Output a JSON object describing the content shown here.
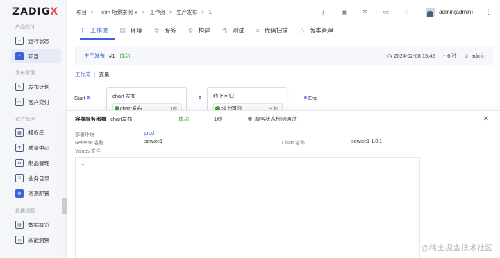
{
  "brand": {
    "logo_main": "ZADIG",
    "logo_accent": "X"
  },
  "sidebar": {
    "sections": [
      {
        "label": "产品交付",
        "items": [
          {
            "label": "运行状态",
            "icon": "pulse-icon"
          },
          {
            "label": "项目",
            "icon": "project-icon",
            "active": true
          }
        ]
      },
      {
        "label": "发布管理",
        "items": [
          {
            "label": "发布计划",
            "icon": "edit-icon"
          },
          {
            "label": "客户交付",
            "icon": "delivery-icon"
          }
        ]
      },
      {
        "label": "资产管理",
        "items": [
          {
            "label": "模板库",
            "icon": "template-icon"
          },
          {
            "label": "质量中心",
            "icon": "quality-icon"
          },
          {
            "label": "制品管理",
            "icon": "artifact-icon"
          },
          {
            "label": "业务目录",
            "icon": "catalog-icon"
          },
          {
            "label": "资源配置",
            "icon": "resource-icon"
          }
        ]
      },
      {
        "label": "数据视图",
        "items": [
          {
            "label": "数据概览",
            "icon": "overview-icon"
          },
          {
            "label": "效能洞察",
            "icon": "insight-icon"
          }
        ]
      }
    ]
  },
  "topbar": {
    "breadcrumb": [
      "项目",
      "Helm 场景案例",
      "工作流",
      "生产发布",
      "1"
    ],
    "user": "admin(admin)"
  },
  "tabs": [
    "工作流",
    "环境",
    "服务",
    "构建",
    "测试",
    "代码扫描",
    "版本管理"
  ],
  "run": {
    "name": "生产发布",
    "number": "#1",
    "status": "成功",
    "time": "2024-02-08 15:42",
    "duration": "6 秒",
    "creator": "admin"
  },
  "subtabs": [
    "工作流",
    "变量"
  ],
  "workflow": {
    "start_label": "Start",
    "end_label": "End",
    "stages": [
      {
        "title": "chart 发布",
        "job": "chart发布",
        "duration": "1秒"
      },
      {
        "title": "线上回归",
        "job": "线上回归",
        "duration": "5 秒"
      }
    ]
  },
  "drawer": {
    "title": "容器服务部署",
    "job": "chart发布",
    "status": "成功",
    "duration": "1秒",
    "check": "服务状态检测通过",
    "fields": {
      "env_label": "部署环境",
      "env_value": "prod",
      "release_label": "Release 名称",
      "release_value": "service1",
      "chart_label": "Chart 名称",
      "chart_value": "service1-1.0.1",
      "values_label": "Values 文件"
    },
    "editor_line": "1"
  },
  "watermark": "@稀土掘金技术社区",
  "colors": {
    "accent": "#3d63d8",
    "success": "#3aa33a",
    "logo_accent": "#e8414e"
  }
}
